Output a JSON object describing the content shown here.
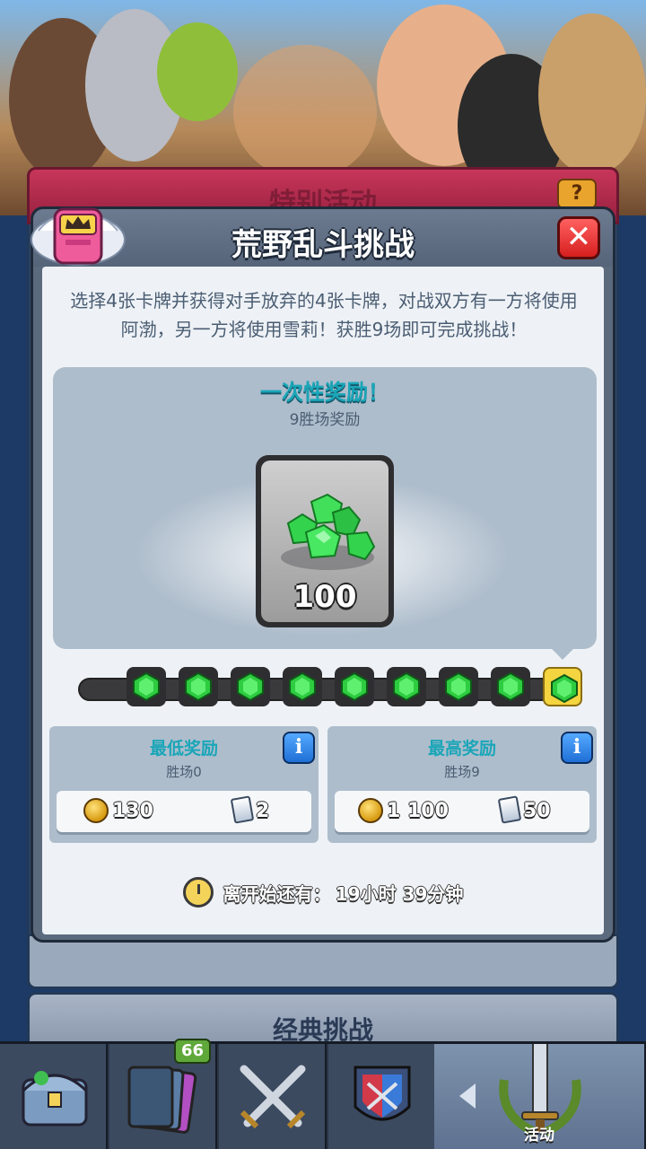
{
  "background": {
    "banner_title": "特别活动",
    "help_label": "?",
    "classic_title": "经典挑战"
  },
  "modal": {
    "title": "荒野乱斗挑战",
    "close_label": "✕",
    "description": "选择4张卡牌并获得对手放弃的4张卡牌，对战双方有一方将使用阿渤，另一方将使用雪莉！获胜9场即可完成挑战！",
    "one_time_reward": {
      "title": "一次性奖励！",
      "subtitle": "9胜场奖励",
      "amount": "100"
    },
    "progress_gem_count": 9,
    "min_reward": {
      "title": "最低奖励",
      "wins": "胜场0",
      "gold": "130",
      "cards": "2",
      "info_label": "i"
    },
    "max_reward": {
      "title": "最高奖励",
      "wins": "胜场9",
      "gold": "1 100",
      "cards": "50",
      "info_label": "i"
    },
    "timer": {
      "label": "离开始还有：",
      "value": "19小时 39分钟"
    }
  },
  "bottom_nav": {
    "cards_badge": "66",
    "events_label": "活动"
  },
  "colors": {
    "gem_green": "#2ecc40",
    "accent_teal": "#1aa6b8",
    "close_red": "#e02a2a",
    "info_blue": "#2a80e8"
  }
}
